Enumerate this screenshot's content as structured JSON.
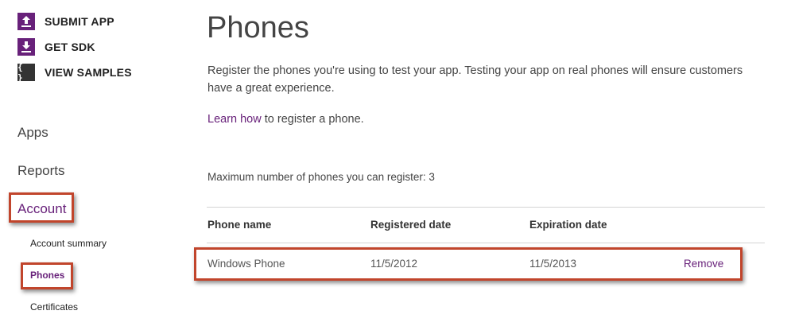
{
  "actions": [
    {
      "label": "SUBMIT APP",
      "icon": "upload-icon",
      "color": "#68217a"
    },
    {
      "label": "GET SDK",
      "icon": "download-icon",
      "color": "#68217a"
    },
    {
      "label": "VIEW SAMPLES",
      "icon": "code-braces-icon",
      "color": "#333333",
      "glyph": "{ }"
    }
  ],
  "nav": {
    "apps": "Apps",
    "reports": "Reports",
    "account": "Account",
    "sub": {
      "summary": "Account summary",
      "phones": "Phones",
      "certificates": "Certificates"
    }
  },
  "main": {
    "title": "Phones",
    "intro": "Register the phones you're using to test your app. Testing your app on real phones will ensure customers have a great experience.",
    "learn_link": "Learn how",
    "learn_rest": " to register a phone.",
    "max_phones": "Maximum number of phones you can register: 3"
  },
  "table": {
    "headers": [
      "Phone name",
      "Registered date",
      "Expiration date"
    ],
    "rows": [
      {
        "name": "Windows Phone",
        "registered": "11/5/2012",
        "expiration": "11/5/2013",
        "action": "Remove"
      }
    ]
  },
  "colors": {
    "accent": "#68217a",
    "highlight": "#c1452c"
  }
}
